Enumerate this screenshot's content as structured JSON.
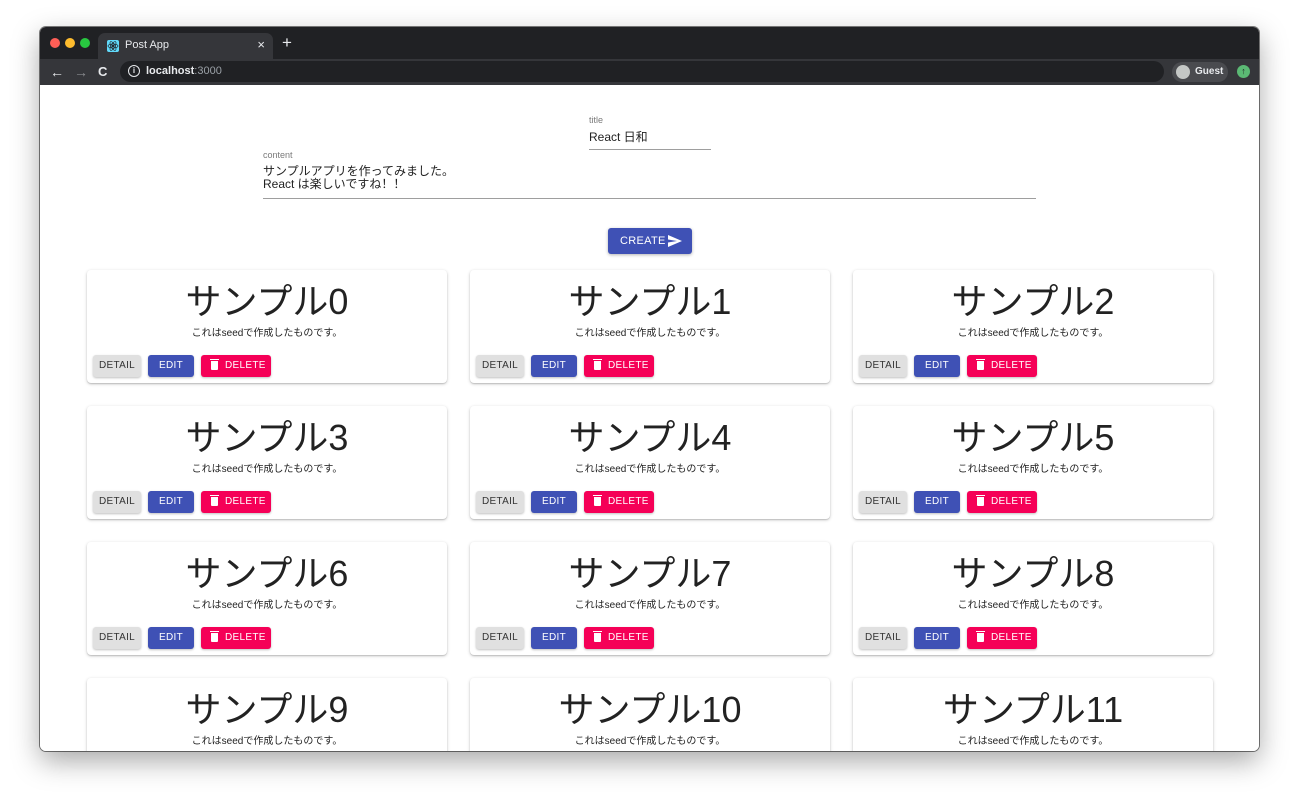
{
  "browser": {
    "tab_title": "Post App",
    "tab_close": "×",
    "new_tab": "+",
    "url_host": "localhost",
    "url_port": ":3000",
    "profile_label": "Guest",
    "nav": {
      "back": "←",
      "forward": "→",
      "reload": "C"
    }
  },
  "form": {
    "title_label": "title",
    "title_value": "React 日和",
    "content_label": "content",
    "content_value": "サンプルアプリを作ってみました。\nReact は楽しいですね！！",
    "create_label": "CREATE"
  },
  "card_actions": {
    "detail": "DETAIL",
    "edit": "EDIT",
    "delete": "DELETE"
  },
  "posts": [
    {
      "title": "サンプル0",
      "content": "これはseedで作成したものです。"
    },
    {
      "title": "サンプル1",
      "content": "これはseedで作成したものです。"
    },
    {
      "title": "サンプル2",
      "content": "これはseedで作成したものです。"
    },
    {
      "title": "サンプル3",
      "content": "これはseedで作成したものです。"
    },
    {
      "title": "サンプル4",
      "content": "これはseedで作成したものです。"
    },
    {
      "title": "サンプル5",
      "content": "これはseedで作成したものです。"
    },
    {
      "title": "サンプル6",
      "content": "これはseedで作成したものです。"
    },
    {
      "title": "サンプル7",
      "content": "これはseedで作成したものです。"
    },
    {
      "title": "サンプル8",
      "content": "これはseedで作成したものです。"
    },
    {
      "title": "サンプル9",
      "content": "これはseedで作成したものです。"
    },
    {
      "title": "サンプル10",
      "content": "これはseedで作成したものです。"
    },
    {
      "title": "サンプル11",
      "content": "これはseedで作成したものです。"
    }
  ],
  "colors": {
    "primary": "#3f51b5",
    "secondary": "#f50057",
    "default_button": "#e0e0e0"
  }
}
